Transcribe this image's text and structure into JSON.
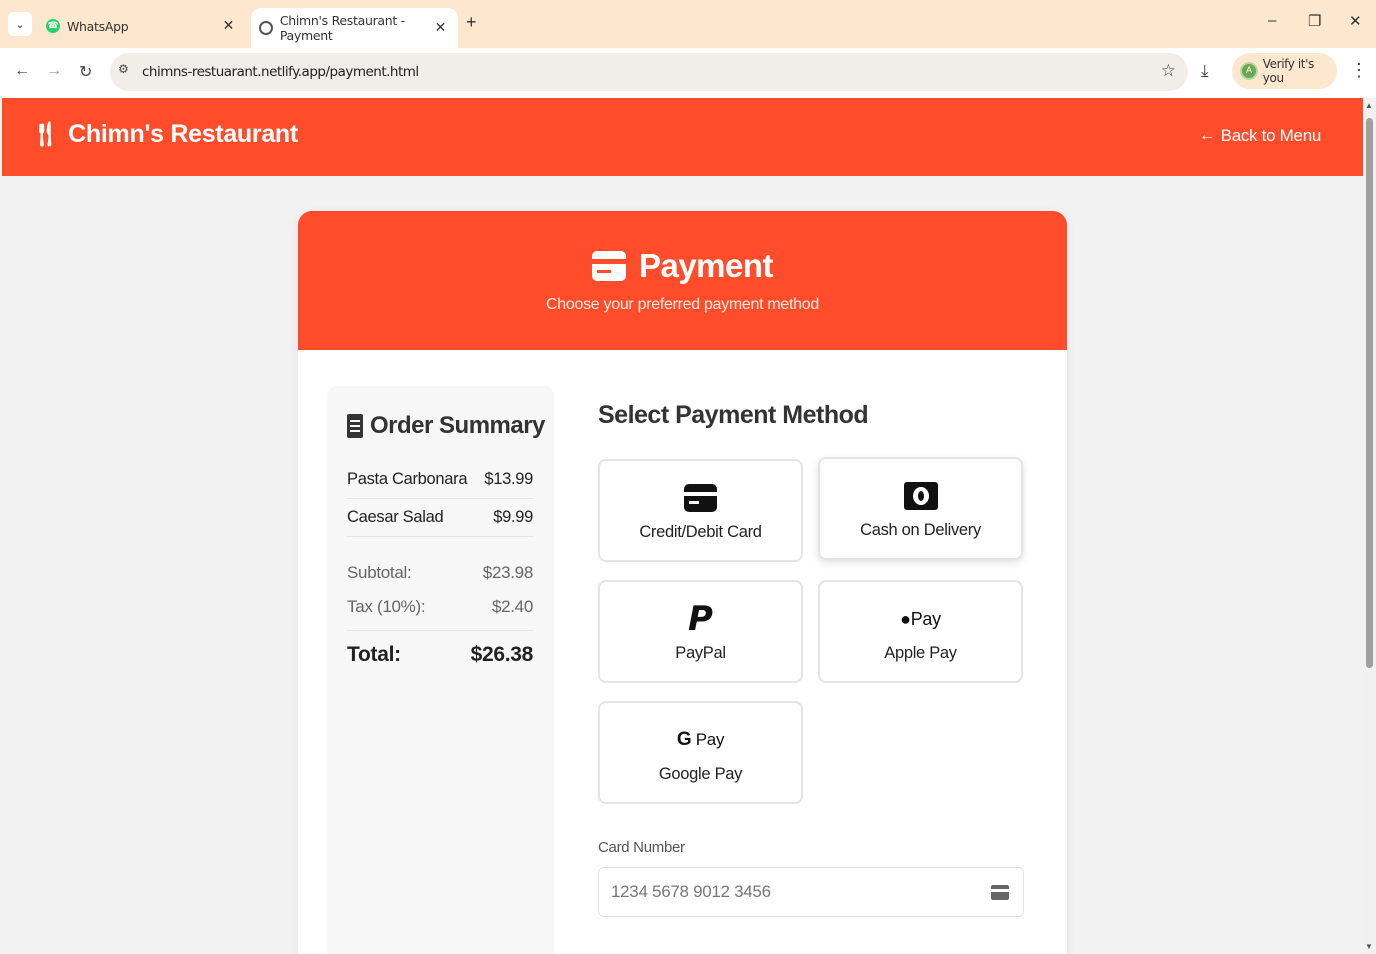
{
  "browser": {
    "tabs": [
      {
        "title": "WhatsApp",
        "icon": "whatsapp-icon"
      },
      {
        "title": "Chimn's Restaurant - Payment",
        "icon": "globe-icon",
        "active": true
      }
    ],
    "url": "chimns-restuarant.netlify.app/payment.html",
    "verify_label": "Verify it's you"
  },
  "header": {
    "brand": "Chimn's Restaurant",
    "back_label": "Back to Menu"
  },
  "payment": {
    "title": "Payment",
    "subtitle": "Choose your preferred payment method"
  },
  "summary": {
    "title": "Order Summary",
    "items": [
      {
        "name": "Pasta Carbonara",
        "price": "$13.99"
      },
      {
        "name": "Caesar Salad",
        "price": "$9.99"
      }
    ],
    "subtotal_label": "Subtotal:",
    "subtotal": "$23.98",
    "tax_label": "Tax (10%):",
    "tax": "$2.40",
    "total_label": "Total:",
    "total": "$26.38"
  },
  "methods": {
    "title": "Select Payment Method",
    "options": [
      {
        "label": "Credit/Debit Card",
        "icon": "credit-card-icon"
      },
      {
        "label": "Cash on Delivery",
        "icon": "cash-icon"
      },
      {
        "label": "PayPal",
        "icon": "paypal-icon"
      },
      {
        "label": "Apple Pay",
        "icon": "apple-pay-icon",
        "icon_text": "Pay"
      },
      {
        "label": "Google Pay",
        "icon": "google-pay-icon",
        "icon_text": "Pay"
      }
    ]
  },
  "card_number": {
    "label": "Card Number",
    "placeholder": "1234 5678 9012 3456"
  },
  "colors": {
    "brand": "#ff4d2b",
    "tabbar": "#fde7cf"
  }
}
